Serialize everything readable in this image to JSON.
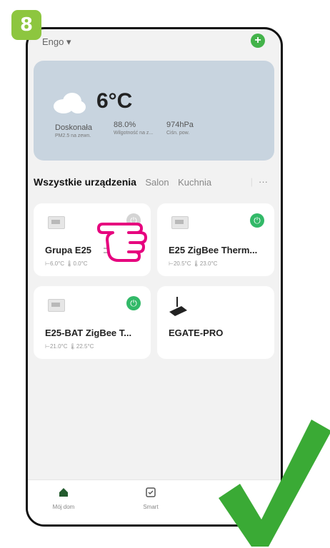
{
  "step": {
    "number": "8"
  },
  "header": {
    "home_name": "Engo",
    "add_icon": "plus-circle-icon"
  },
  "weather": {
    "temperature": "6°C",
    "air_quality_value": "Doskonała",
    "air_quality_label": "PM2.5 na zewn.",
    "humidity_value": "88.0%",
    "humidity_label": "Wilgotność na z...",
    "pressure_value": "974hPa",
    "pressure_label": "Ciśn. pow."
  },
  "tabs": {
    "active": "Wszystkie urządzenia",
    "items": [
      "Salon",
      "Kuchnia"
    ],
    "more": "···"
  },
  "devices": [
    {
      "name": "Grupa E25",
      "set_temp": "6.0°C",
      "current_temp": "0.0°C",
      "power": "off"
    },
    {
      "name": "E25 ZigBee Therm...",
      "set_temp": "20.5°C",
      "current_temp": "23.0°C",
      "power": "on"
    },
    {
      "name": "E25-BAT ZigBee T...",
      "set_temp": "21.0°C",
      "current_temp": "22.5°C",
      "power": "on"
    },
    {
      "name": "EGATE-PRO"
    }
  ],
  "bottom_nav": {
    "items": [
      {
        "label": "Mój dom",
        "icon": "home-icon"
      },
      {
        "label": "Smart",
        "icon": "check-square-icon"
      },
      {
        "label": "",
        "icon": "profile-icon"
      }
    ]
  },
  "colors": {
    "accent_green": "#32b968",
    "badge_green": "#8dc63f",
    "hand_pink": "#e6007e",
    "check_green": "#3aaa35"
  }
}
